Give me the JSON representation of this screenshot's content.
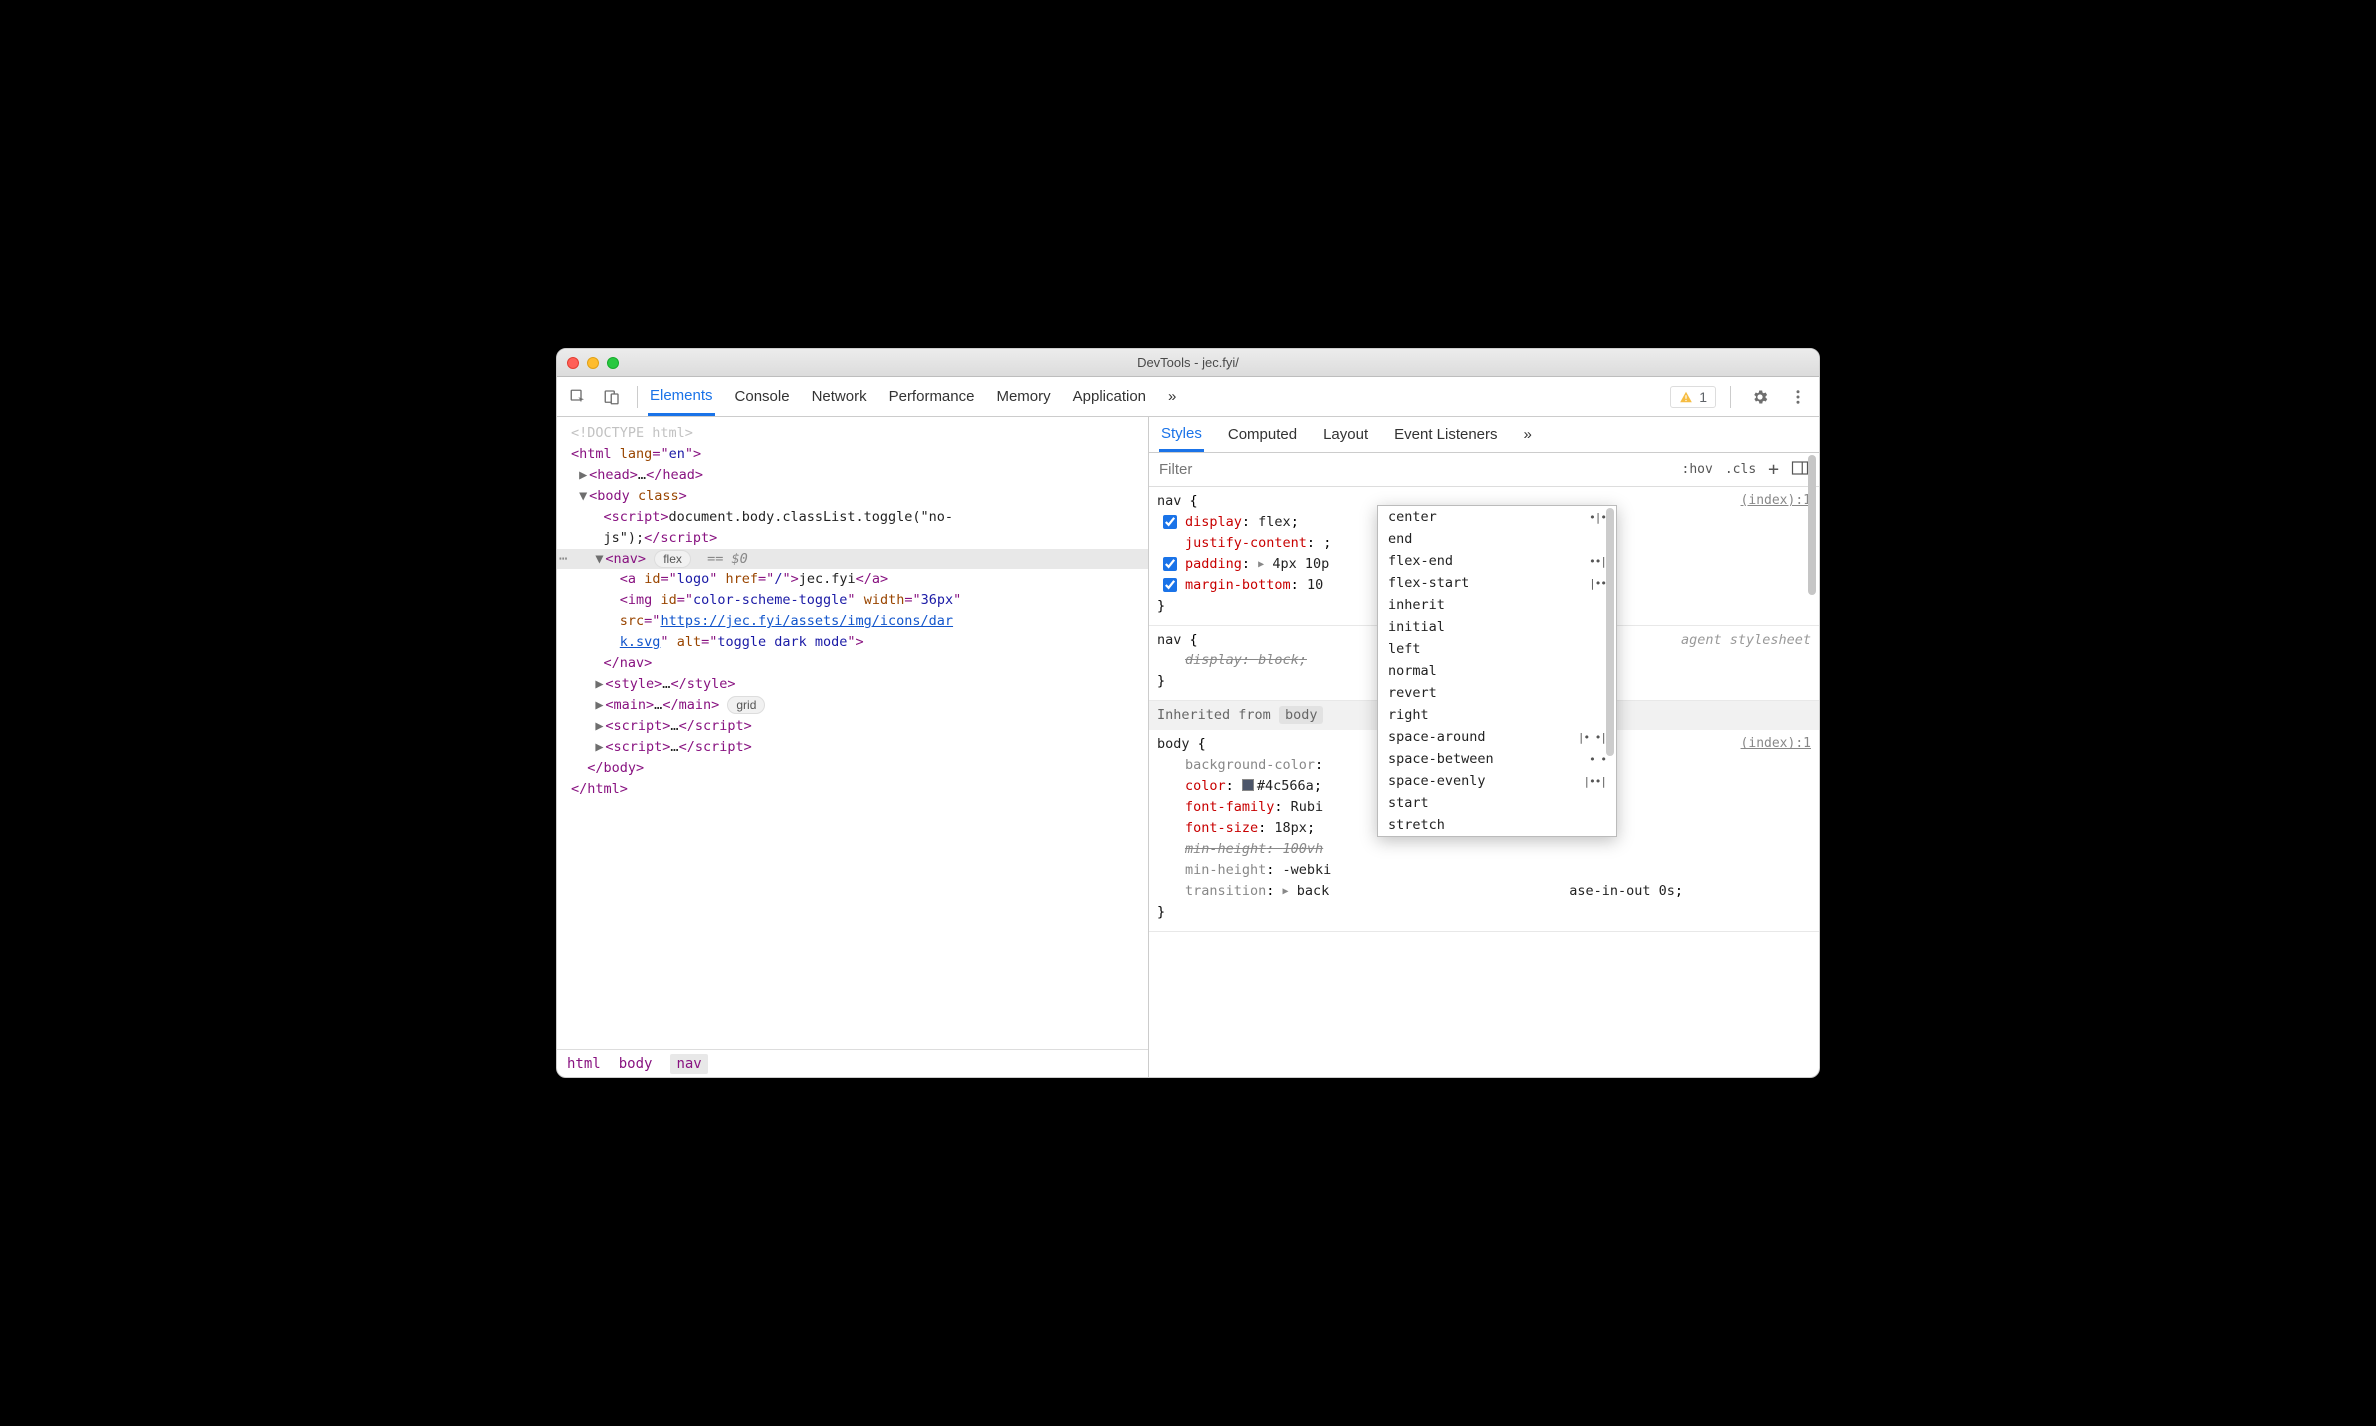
{
  "window": {
    "title": "DevTools - jec.fyi/"
  },
  "mainTabs": {
    "items": [
      "Elements",
      "Console",
      "Network",
      "Performance",
      "Memory",
      "Application"
    ],
    "activeIndex": 0,
    "moreGlyph": "»"
  },
  "warnings": {
    "count": "1"
  },
  "dom": {
    "doctype": "<!DOCTYPE html>",
    "htmlOpen": {
      "tagOpen": "<",
      "tag": "html",
      "sp": " ",
      "attr": "lang",
      "eq": "=\"",
      "val": "en",
      "close": "\">"
    },
    "head": {
      "open": "<head>",
      "ell": "…",
      "close": "</head>"
    },
    "bodyOpen": {
      "open": "<",
      "tag": "body",
      "sp": " ",
      "attr": "class",
      "close": ">"
    },
    "scriptInline": {
      "open": "<script>",
      "text1": "document.body.classList.toggle(\"no-",
      "text2": "js\");",
      "close": "</script>"
    },
    "nav": {
      "open": "<",
      "tag": "nav",
      "close": ">",
      "badge": "flex",
      "eqdol": "== $0",
      "a": {
        "open": "<",
        "tag": "a",
        "id_k": "id",
        "id_v": "logo",
        "href_k": "href",
        "href_v": "/",
        "close": ">",
        "text": "jec.fyi",
        "closeTag": "</a>"
      },
      "img": {
        "open": "<",
        "tag": "img",
        "id_k": "id",
        "id_v": "color-scheme-toggle",
        "w_k": "width",
        "w_v": "36px",
        "src_k": "src",
        "src_v1": "https://jec.fyi/assets/img/icons/dar",
        "src_v2": "k.svg",
        "alt_k": "alt",
        "alt_v": "toggle dark mode",
        "close": ">"
      },
      "closeTag": "</nav>"
    },
    "style": {
      "open": "<style>",
      "ell": "…",
      "close": "</style>"
    },
    "main": {
      "open": "<main>",
      "ell": "…",
      "close": "</main>",
      "badge": "grid"
    },
    "script1": {
      "open": "<script>",
      "ell": "…",
      "close": "</script>"
    },
    "script2": {
      "open": "<script>",
      "ell": "…",
      "close": "</script>"
    },
    "bodyClose": "</body>",
    "htmlClose": "</html>"
  },
  "breadcrumb": {
    "items": [
      "html",
      "body",
      "nav"
    ],
    "selectedIndex": 2
  },
  "rightTabs": {
    "items": [
      "Styles",
      "Computed",
      "Layout",
      "Event Listeners"
    ],
    "activeIndex": 0,
    "moreGlyph": "»"
  },
  "filter": {
    "placeholder": "Filter",
    "hov": ":hov",
    "cls": ".cls",
    "plus": "+"
  },
  "styles": {
    "rule1": {
      "selector": "nav",
      "brO": " {",
      "brC": "}",
      "src": "(index):1",
      "p1": {
        "name": "display",
        "value": "flex"
      },
      "p2": {
        "name": "justify-content",
        "value": ""
      },
      "p3": {
        "name": "padding",
        "value": "4px 10p"
      },
      "p4": {
        "name": "margin-bottom",
        "value": "10"
      }
    },
    "rule2": {
      "selector": "nav",
      "brO": " {",
      "brC": "}",
      "ua": "agent stylesheet",
      "p1": {
        "name": "display",
        "value": "block"
      }
    },
    "inherit": {
      "label": "Inherited from",
      "from": "body"
    },
    "rule3": {
      "selector": "body",
      "brO": " {",
      "brC": "}",
      "src": "(index):1",
      "p1": {
        "name": "background-color",
        "value": ""
      },
      "p2": {
        "name": "color",
        "value": "#4c566a"
      },
      "p3": {
        "name": "font-family",
        "value": "Rubi"
      },
      "p4": {
        "name": "font-size",
        "value": "18px"
      },
      "p5": {
        "name": "min-height",
        "value": "100vh"
      },
      "p6": {
        "name": "min-height",
        "value": "-webki"
      },
      "p7": {
        "name": "transition",
        "value": "back",
        "tail": "ase-in-out 0s"
      }
    }
  },
  "autocomplete": {
    "items": [
      {
        "label": "center",
        "glyph": "•|•"
      },
      {
        "label": "end",
        "glyph": ""
      },
      {
        "label": "flex-end",
        "glyph": "••|"
      },
      {
        "label": "flex-start",
        "glyph": "|••"
      },
      {
        "label": "inherit",
        "glyph": ""
      },
      {
        "label": "initial",
        "glyph": ""
      },
      {
        "label": "left",
        "glyph": ""
      },
      {
        "label": "normal",
        "glyph": ""
      },
      {
        "label": "revert",
        "glyph": ""
      },
      {
        "label": "right",
        "glyph": ""
      },
      {
        "label": "space-around",
        "glyph": "|• •|"
      },
      {
        "label": "space-between",
        "glyph": "•  •"
      },
      {
        "label": "space-evenly",
        "glyph": "|••|"
      },
      {
        "label": "start",
        "glyph": ""
      },
      {
        "label": "stretch",
        "glyph": ""
      }
    ]
  },
  "colors": {
    "swatch_4c566a": "#4c566a"
  }
}
